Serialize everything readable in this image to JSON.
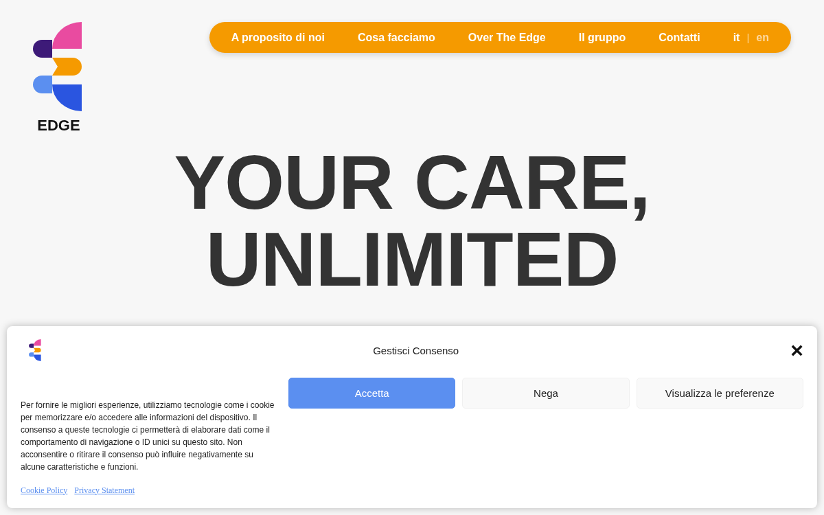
{
  "logo": {
    "wordmark": "EDGE"
  },
  "nav": {
    "items": [
      "A proposito di noi",
      "Cosa facciamo",
      "Over The Edge",
      "Il gruppo",
      "Contatti"
    ],
    "languages": [
      {
        "label": "it",
        "selected": true
      },
      {
        "label": "en",
        "selected": false
      }
    ],
    "separator": "|"
  },
  "hero": {
    "lines": [
      "YOUR CARE,",
      "UNLIMITED"
    ]
  },
  "consent": {
    "title": "Gestisci Consenso",
    "close": "×",
    "text": "Per fornire le migliori esperienze, utilizziamo tecnologie come i cookie per memorizzare e/o accedere alle informazioni del dispositivo. Il consenso a queste tecnologie ci permetterà di elaborare dati come il comportamento di navigazione o ID unici su questo sito. Non acconsentire o ritirare il consenso può influire negativamente su alcune caratteristiche e funzioni.",
    "buttons": [
      {
        "label": "Accetta",
        "kind": "primary"
      },
      {
        "label": "Nega",
        "kind": "secondary"
      },
      {
        "label": "Visualizza le preferenze",
        "kind": "secondary"
      }
    ],
    "links": [
      "Cookie Policy",
      "Privacy Statement"
    ]
  }
}
